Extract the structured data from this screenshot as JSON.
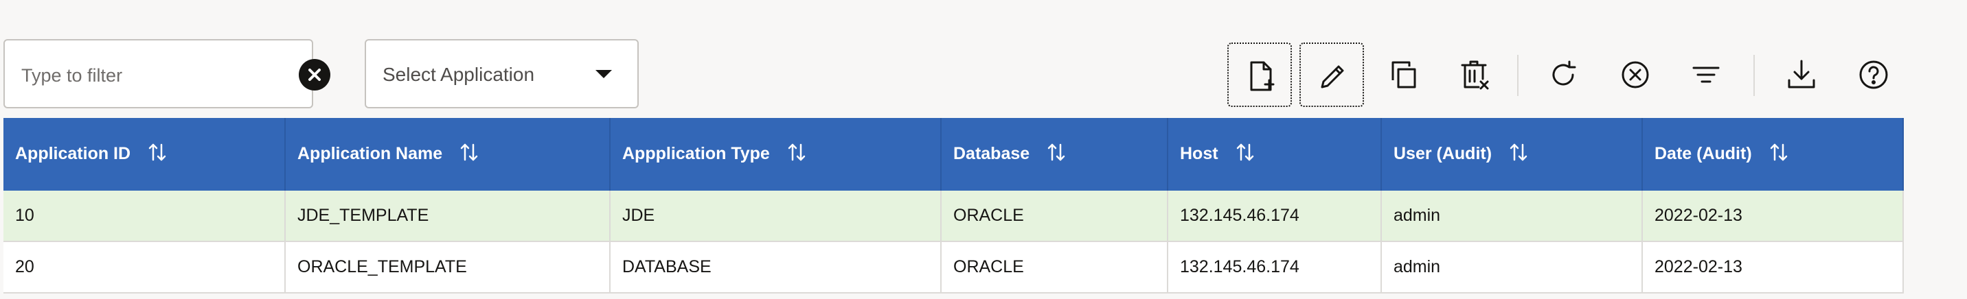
{
  "filter": {
    "placeholder": "Type to filter",
    "value": ""
  },
  "application_select": {
    "label": "Select Application"
  },
  "toolbar": {
    "buttons": [
      {
        "name": "new-file-button",
        "icon": "file-plus-icon"
      },
      {
        "name": "edit-button",
        "icon": "pencil-icon"
      },
      {
        "name": "copy-button",
        "icon": "copy-icon"
      },
      {
        "name": "delete-button",
        "icon": "trash-icon"
      },
      {
        "name": "refresh-button",
        "icon": "refresh-icon"
      },
      {
        "name": "cancel-button",
        "icon": "close-circle-icon"
      },
      {
        "name": "filter-button",
        "icon": "filter-lines-icon"
      },
      {
        "name": "download-button",
        "icon": "download-icon"
      },
      {
        "name": "help-button",
        "icon": "help-icon"
      }
    ]
  },
  "table": {
    "columns": [
      "Application ID",
      "Application Name",
      "Appplication Type",
      "Database",
      "Host",
      "User (Audit)",
      "Date (Audit)"
    ],
    "rows": [
      [
        "10",
        "JDE_TEMPLATE",
        "JDE",
        "ORACLE",
        "132.145.46.174",
        "admin",
        "2022-02-13"
      ],
      [
        "20",
        "ORACLE_TEMPLATE",
        "DATABASE",
        "ORACLE",
        "132.145.46.174",
        "admin",
        "2022-02-13"
      ]
    ],
    "selected_row": 0
  },
  "colors": {
    "header_bg": "#3367b7",
    "selected_row_bg": "#e6f3de",
    "page_bg": "#f8f7f6"
  }
}
